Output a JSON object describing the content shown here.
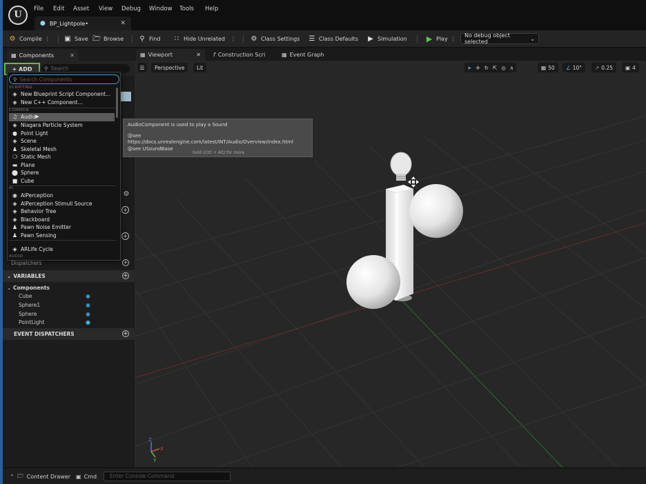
{
  "app": {
    "logo_label": "U",
    "menu": [
      "File",
      "Edit",
      "Asset",
      "View",
      "Debug",
      "Window",
      "Tools",
      "Help"
    ],
    "document_tab": "BP_Lightpole•"
  },
  "toolbar": {
    "compile": "Compile",
    "save": "Save",
    "browse": "Browse",
    "find": "Find",
    "hide_unrelated": "Hide Unrelated",
    "class_settings": "Class Settings",
    "class_defaults": "Class Defaults",
    "simulation": "Simulation",
    "play": "Play",
    "debug_select": "No debug object selected"
  },
  "components_panel": {
    "tab_label": "Components",
    "add_label": "+ ADD",
    "search_placeholder": "Search"
  },
  "add_dropdown": {
    "search_placeholder": "Search Components",
    "categories": {
      "scripting": "SCRIPTING",
      "common": "COMMON",
      "ai": "AI",
      "audio": "AUDIO"
    },
    "scripting_items": [
      {
        "label": "New Blueprint Script Component...",
        "icon": "blueprint-icon"
      },
      {
        "label": "New C++ Component...",
        "icon": "cpp-icon"
      }
    ],
    "common_items": [
      {
        "label": "Audio",
        "icon": "audio-icon",
        "selected": true
      },
      {
        "label": "Niagara Particle System",
        "icon": "niagara-icon"
      },
      {
        "label": "Point Light",
        "icon": "point-light-icon"
      },
      {
        "label": "Scene",
        "icon": "scene-icon"
      },
      {
        "label": "Skeletal Mesh",
        "icon": "skeletal-mesh-icon"
      },
      {
        "label": "Static Mesh",
        "icon": "static-mesh-icon"
      },
      {
        "label": "Plane",
        "icon": "plane-icon"
      },
      {
        "label": "Sphere",
        "icon": "sphere-icon"
      },
      {
        "label": "Cube",
        "icon": "cube-icon"
      }
    ],
    "ai_items": [
      {
        "label": "AIPerception",
        "icon": "ai-perception-icon"
      },
      {
        "label": "AIPerception Stimuli Source",
        "icon": "stimuli-icon"
      },
      {
        "label": "Behavior Tree",
        "icon": "behavior-tree-icon"
      },
      {
        "label": "Blackboard",
        "icon": "blackboard-icon"
      },
      {
        "label": "Pawn Noise Emitter",
        "icon": "noise-emitter-icon"
      },
      {
        "label": "Pawn Sensing",
        "icon": "pawn-sensing-icon"
      }
    ],
    "audio_items": [
      {
        "label": "ARLife Cycle",
        "icon": "ar-lifecycle-icon"
      }
    ]
  },
  "tooltip": {
    "line1": "AudioComponent is used to play a Sound",
    "line2": "@see https://docs.unrealengine.com/latest/INT/Audio/Overview/index.html",
    "line3": "@see USoundBase",
    "hint": "hold (Ctrl + Alt) for more"
  },
  "my_blueprint": {
    "cut_off_label": "Dispatchers",
    "variables_header": "VARIABLES",
    "components_group": "Components",
    "variables": [
      {
        "name": "Cube",
        "icon": "mesh-var-icon"
      },
      {
        "name": "Sphere1",
        "icon": "mesh-var-icon"
      },
      {
        "name": "Sphere",
        "icon": "mesh-var-icon"
      },
      {
        "name": "PointLight",
        "icon": "light-var-icon"
      }
    ],
    "event_dispatchers_header": "EVENT DISPATCHERS"
  },
  "doc_tabs": [
    "Viewport",
    "Construction Scri",
    "Event Graph"
  ],
  "viewport": {
    "perspective": "Perspective",
    "lit": "Lit",
    "grid_snap": "50",
    "rotation_snap": "10°",
    "scale_snap": "0.25",
    "camera_speed": "4",
    "axis_labels": {
      "x": "X",
      "y": "Y",
      "z": "Z"
    },
    "colors": {
      "grid": "#343434",
      "x_axis": "#7a2b2b",
      "y_axis": "#2f6a2f"
    }
  },
  "bottom": {
    "content_drawer": "Content Drawer",
    "cmd": "Cmd",
    "console_placeholder": "Enter Console Command"
  }
}
